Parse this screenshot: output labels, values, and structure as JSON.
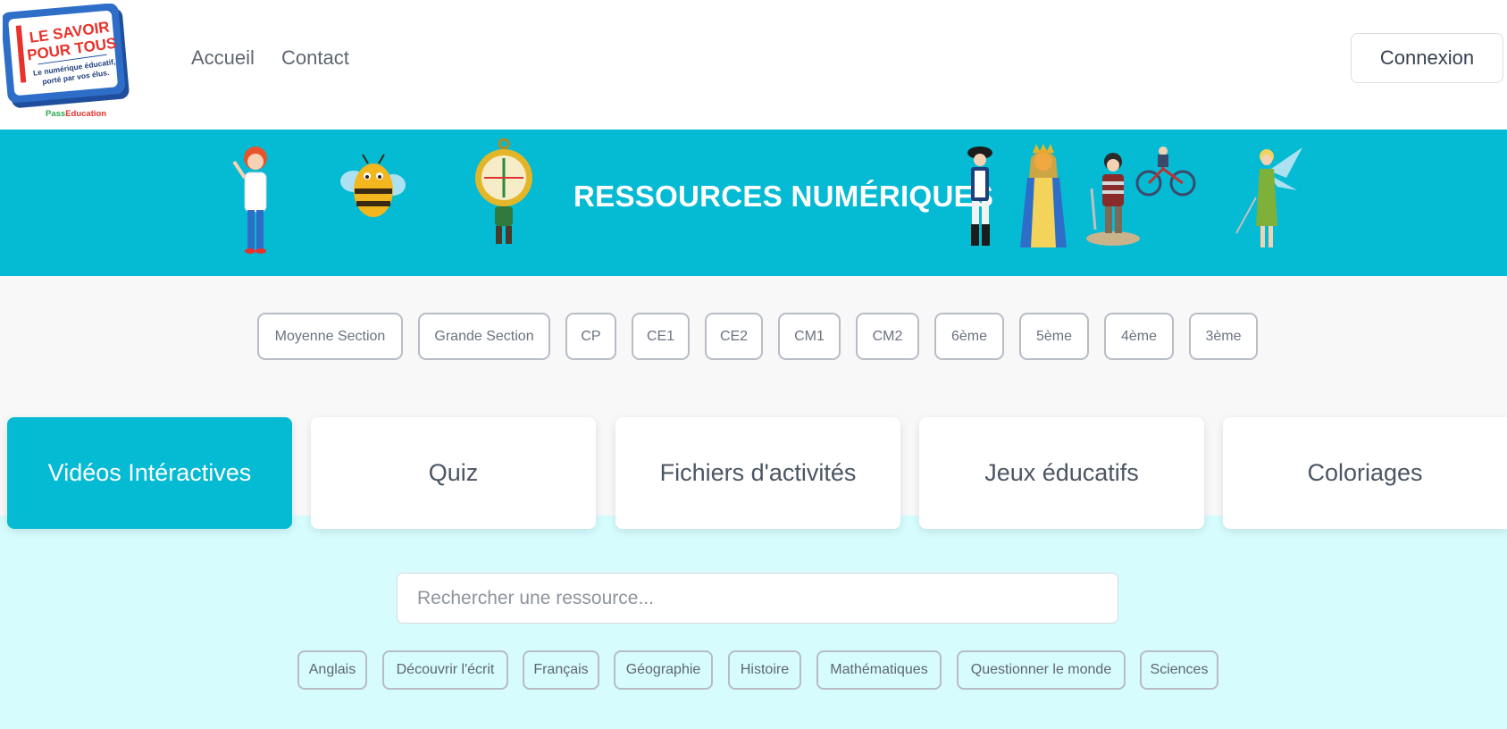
{
  "logo": {
    "line1": "LE SAVOIR",
    "line2": "POUR TOUS",
    "tagline1": "Le numérique éducatif,",
    "tagline2": "porté par vos élus.",
    "brand_part1": "Pass",
    "brand_part2": "Education"
  },
  "nav": {
    "items": [
      {
        "label": "Accueil"
      },
      {
        "label": "Contact"
      }
    ],
    "login_label": "Connexion"
  },
  "banner": {
    "title": "RESSOURCES NUMÉRIQUES",
    "background": "#05bad3"
  },
  "levels": [
    {
      "label": "Moyenne Section"
    },
    {
      "label": "Grande Section"
    },
    {
      "label": "CP"
    },
    {
      "label": "CE1"
    },
    {
      "label": "CE2"
    },
    {
      "label": "CM1"
    },
    {
      "label": "CM2"
    },
    {
      "label": "6ème"
    },
    {
      "label": "5ème"
    },
    {
      "label": "4ème"
    },
    {
      "label": "3ème"
    }
  ],
  "categories": [
    {
      "label": "Vidéos Intéractives",
      "active": true
    },
    {
      "label": "Quiz",
      "active": false
    },
    {
      "label": "Fichiers d'activités",
      "active": false
    },
    {
      "label": "Jeux éducatifs",
      "active": false
    },
    {
      "label": "Coloriages",
      "active": false
    }
  ],
  "search": {
    "placeholder": "Rechercher une ressource...",
    "value": ""
  },
  "subjects": [
    {
      "label": "Anglais"
    },
    {
      "label": "Découvrir l'écrit"
    },
    {
      "label": "Français"
    },
    {
      "label": "Géographie"
    },
    {
      "label": "Histoire"
    },
    {
      "label": "Mathématiques"
    },
    {
      "label": "Questionner le monde"
    },
    {
      "label": "Sciences"
    }
  ],
  "colors": {
    "accent": "#05bad3",
    "lower_background": "#d6fcfd",
    "levels_background": "#f8f8f9",
    "logo_red": "#e8322b",
    "logo_blue": "#1f4f9c"
  }
}
